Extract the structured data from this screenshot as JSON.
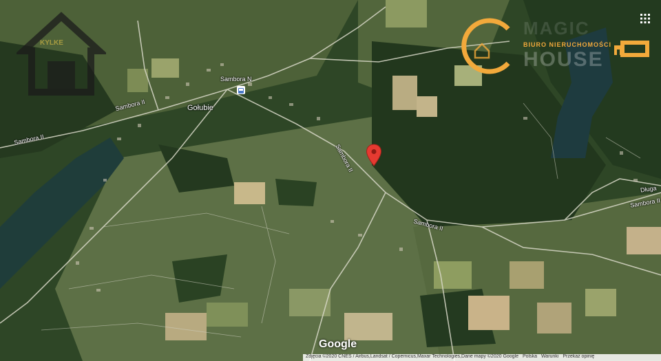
{
  "map": {
    "labels": {
      "village": "Gołubie",
      "road_sambora_n": "Sambora N",
      "road_sambora_ii_1": "Sambora II",
      "road_sambora_ii_2": "Sambora II",
      "road_sambora_ii_3": "Sambora II",
      "road_sambora_ii_4": "Sambora II",
      "road_sambora_ii_5": "Sambora II",
      "road_dluga": "Długa"
    },
    "google_logo": "Google",
    "attribution": {
      "data": "Zdjęcia ©2020 CNES / Airbus,Landsat / Copernicus,Maxar Technologies,Dane mapy ©2020 Google",
      "country": "Polska",
      "terms": "Warunki",
      "report": "Przekaż opinię"
    },
    "marker_icon": "map-pin-icon",
    "transit_icon": "bus-stop-icon",
    "menu_icon": "apps-grid-icon"
  },
  "watermarks": {
    "left_text": "KYLKE",
    "right_subtitle": "BIURO NIERUCHOMOŚCI",
    "right_title": "HOUSE",
    "right_top": "MAGIC",
    "brand_color": "#f2a93b"
  }
}
